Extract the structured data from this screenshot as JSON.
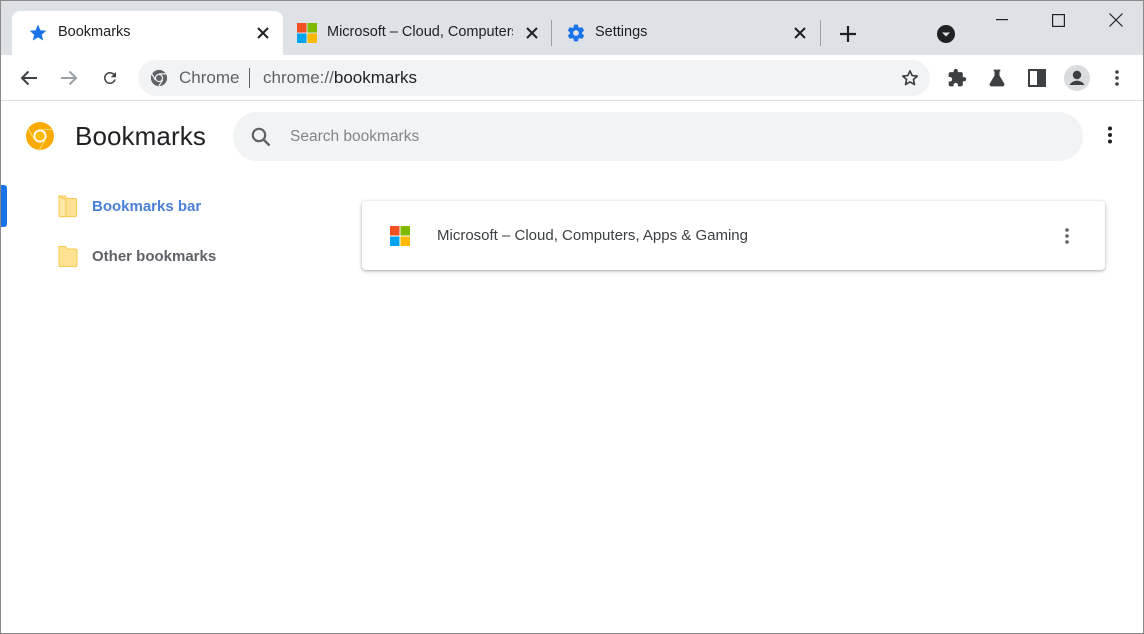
{
  "tabs": [
    {
      "title": "Bookmarks",
      "icon": "bookmark-star-icon",
      "active": true
    },
    {
      "title": "Microsoft – Cloud, Computers, Apps & Gaming",
      "icon": "microsoft-logo-icon",
      "active": false
    },
    {
      "title": "Settings",
      "icon": "settings-gear-icon",
      "active": false
    }
  ],
  "toolbar": {
    "chip_label": "Chrome",
    "url_scheme": "chrome://",
    "url_path": "bookmarks"
  },
  "page": {
    "title": "Bookmarks",
    "search_placeholder": "Search bookmarks"
  },
  "sidebar": {
    "items": [
      {
        "label": "Bookmarks bar",
        "selected": true
      },
      {
        "label": "Other bookmarks",
        "selected": false
      }
    ]
  },
  "bookmarks": [
    {
      "title": "Microsoft – Cloud, Computers, Apps & Gaming",
      "icon": "microsoft-logo-icon"
    }
  ],
  "colors": {
    "accent": "#1a73e8",
    "tabstrip": "#dee1e6",
    "selected_label": "#4a80d8",
    "folder": "#fde293"
  }
}
